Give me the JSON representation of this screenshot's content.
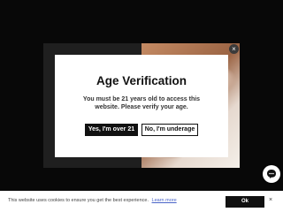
{
  "promo": {
    "close_glyph": "×"
  },
  "modal": {
    "title": "Age Verification",
    "message": "You must be 21 years old to access this website. Please verify your age.",
    "yes_label": "Yes, I'm over 21",
    "no_label": "No, I'm underage"
  },
  "chat": {
    "icon": "chat-bubble-icon"
  },
  "cookie": {
    "text": "This website uses cookies to ensure you get the best experience.",
    "link_label": "Learn more",
    "ok_label": "Ok",
    "close_glyph": "×"
  },
  "colors": {
    "background": "#080808",
    "modal": "#ffffff",
    "button_dark": "#111111",
    "link": "#4a64c8"
  }
}
